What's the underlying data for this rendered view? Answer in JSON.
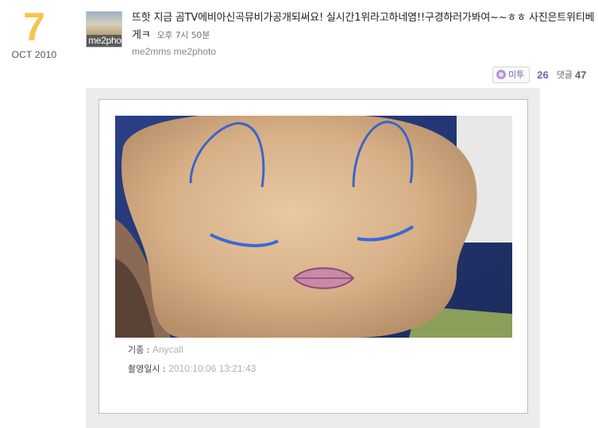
{
  "date": {
    "day": "7",
    "month_year": "OCT 2010"
  },
  "avatar": {
    "label": "me2pho"
  },
  "post": {
    "text": "뜨핫 지금 곰TV에비아신곡뮤비가공개되써요! 실시간1위라고하네염!!구경하러가봐여~~ㅎㅎ 사진은트위티베게ㅋ",
    "time": "오후 7시 50분",
    "tags": "me2mms me2photo"
  },
  "actions": {
    "metoo_label": "미투",
    "metoo_count": "26",
    "comment_label": "댓글",
    "comment_count": "47"
  },
  "photo": {
    "device_label": "기종 :",
    "device_value": "Anycall",
    "taken_label": "촬영일시 :",
    "taken_value": "2010:10:06 13:21:43"
  },
  "colors": {
    "date_accent": "#f7c44a",
    "metoo_accent": "#7a5fa3"
  },
  "icons": {
    "metoo": "metoo-icon"
  }
}
